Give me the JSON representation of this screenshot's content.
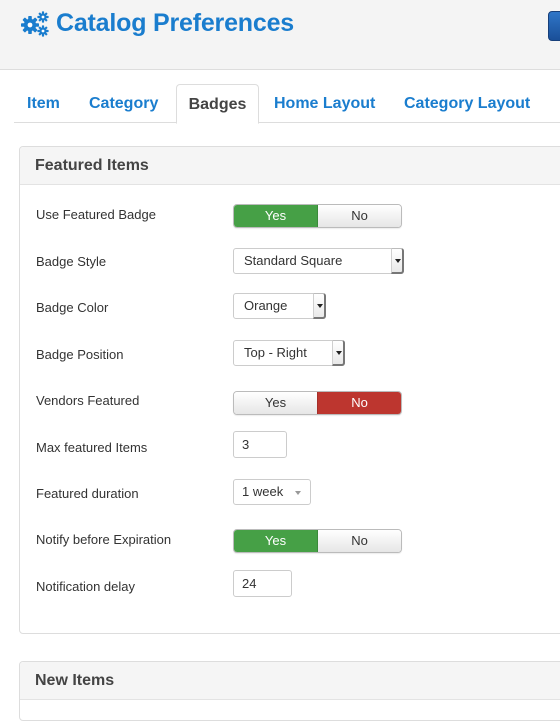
{
  "header": {
    "title": "Catalog Preferences",
    "icon": "gears-icon",
    "brand_color": "#1a7dce"
  },
  "tabs": [
    {
      "label": "Item",
      "active": false
    },
    {
      "label": "Category",
      "active": false
    },
    {
      "label": "Badges",
      "active": true
    },
    {
      "label": "Home Layout",
      "active": false
    },
    {
      "label": "Category Layout",
      "active": false
    }
  ],
  "featured": {
    "title": "Featured Items",
    "fields": {
      "use_featured_badge": {
        "label": "Use Featured Badge",
        "yes": "Yes",
        "no": "No",
        "value": "Yes"
      },
      "badge_style": {
        "label": "Badge Style",
        "value": "Standard Square"
      },
      "badge_color": {
        "label": "Badge Color",
        "value": "Orange"
      },
      "badge_position": {
        "label": "Badge Position",
        "value": "Top - Right"
      },
      "vendors_featured": {
        "label": "Vendors Featured",
        "yes": "Yes",
        "no": "No",
        "value": "No"
      },
      "max_featured_items": {
        "label": "Max featured Items",
        "value": "3"
      },
      "featured_duration": {
        "label": "Featured duration",
        "value": "1 week"
      },
      "notify_before_expiration": {
        "label": "Notify before Expiration",
        "yes": "Yes",
        "no": "No",
        "value": "Yes"
      },
      "notification_delay": {
        "label": "Notification delay",
        "value": "24"
      }
    }
  },
  "new_items": {
    "title": "New Items"
  },
  "colors": {
    "yes_active": "#46a046",
    "no_active": "#bd362f",
    "link": "#1a7dce"
  }
}
